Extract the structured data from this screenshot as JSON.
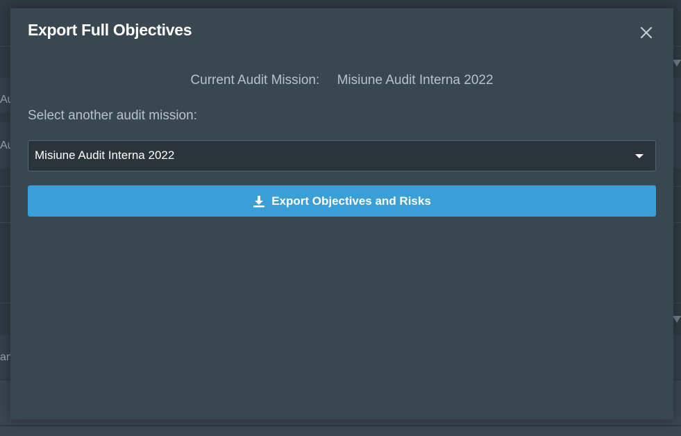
{
  "background": {
    "left_labels": [
      "Au",
      "Au",
      "anc"
    ]
  },
  "modal": {
    "title": "Export Full Objectives",
    "close_icon": "close-icon",
    "current_mission_label": "Current Audit Mission:",
    "current_mission_value": "Misiune Audit Interna 2022",
    "select_label": "Select another audit mission:",
    "select_value": "Misiune Audit Interna 2022",
    "export_icon": "download-icon",
    "export_label": "Export Objectives and Risks"
  },
  "colors": {
    "modal_bg": "#394750",
    "primary_button": "#3a9fd6",
    "select_bg": "#29343b",
    "text_primary": "#ffffff",
    "text_muted": "#b9c2c8"
  }
}
